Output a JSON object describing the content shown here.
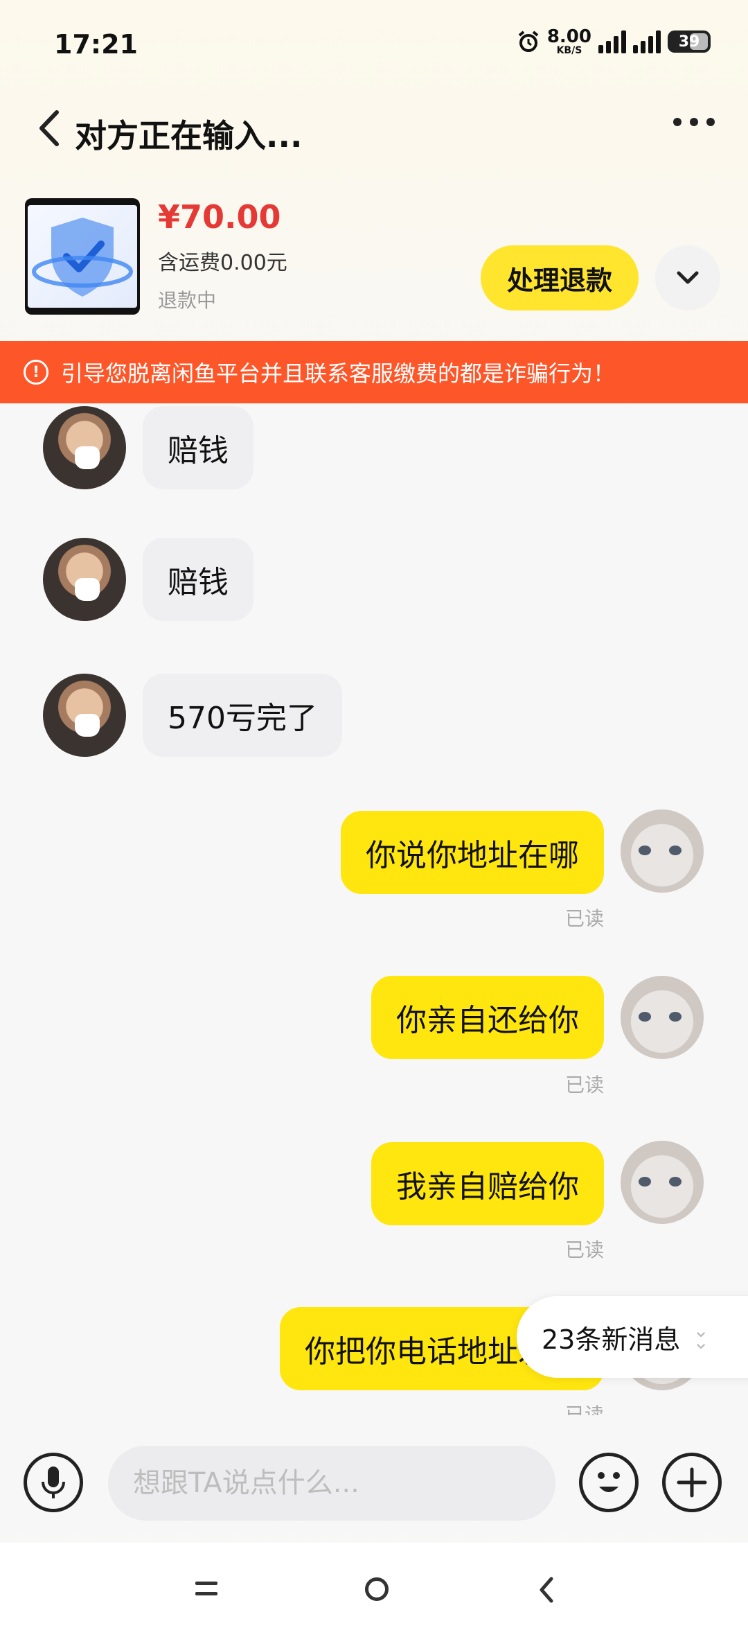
{
  "status_bar": {
    "time": "17:21",
    "net_speed_value": "8.00",
    "net_speed_unit": "KB/S",
    "battery": "39",
    "icons": [
      "alarm-icon",
      "signal-icon",
      "signal-icon",
      "battery-icon"
    ]
  },
  "header": {
    "title": "对方正在输入..."
  },
  "product": {
    "price": "¥70.00",
    "shipping": "含运费0.00元",
    "status": "退款中",
    "refund_button": "处理退款",
    "accent_color": "#e53935"
  },
  "warning": {
    "text": "引导您脱离闲鱼平台并且联系客服缴费的都是诈骗行为！",
    "color": "#fd5629"
  },
  "messages": [
    {
      "from": "them",
      "text": "赔钱"
    },
    {
      "from": "them",
      "text": "赔钱"
    },
    {
      "from": "them",
      "text": "570亏完了"
    },
    {
      "from": "me",
      "text": "你说你地址在哪",
      "status": "已读"
    },
    {
      "from": "me",
      "text": "你亲自还给你",
      "status": "已读"
    },
    {
      "from": "me",
      "text": "我亲自赔给你",
      "status": "已读"
    },
    {
      "from": "me",
      "text": "你把你电话地址发给",
      "status": "已读"
    }
  ],
  "new_messages": {
    "label": "23条新消息"
  },
  "input": {
    "placeholder": "想跟TA说点什么..."
  },
  "theme": {
    "bubble_me": "#ffe60f",
    "bubble_them": "#efeff2",
    "button_yellow": "#ffe52e"
  }
}
